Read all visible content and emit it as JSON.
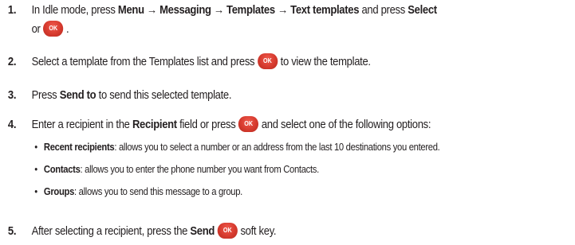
{
  "ok_key_label": "OK",
  "steps": [
    {
      "number": "1.",
      "line1_a": "In Idle mode, press ",
      "line1_b": "Menu → Messaging → Templates → Text templates",
      "line1_c": " and press ",
      "line1_d": "Select",
      "line2_a": "or",
      "line2_b": "."
    },
    {
      "number": "2.",
      "text_a": "Select a template from the Templates list and press",
      "text_b": "to view the template."
    },
    {
      "number": "3.",
      "text_a": "Press ",
      "text_b": "Send to",
      "text_c": " to send this selected template."
    },
    {
      "number": "4.",
      "text_a": "Enter a recipient in the ",
      "text_b": "Recipient",
      "text_c": " field or press",
      "text_d": "and select one of the following options:",
      "options": [
        {
          "title": "Recent recipients",
          "desc": ": allows you to select a number or an address from the last 10 destinations you entered."
        },
        {
          "title": "Contacts",
          "desc": ": allows you to enter the phone number you want from Contacts."
        },
        {
          "title": "Groups",
          "desc": ": allows you to send this message to a group."
        }
      ]
    },
    {
      "number": "5.",
      "text_a": "After selecting a recipient, press the ",
      "text_b": "Send",
      "text_c": "soft key."
    }
  ]
}
